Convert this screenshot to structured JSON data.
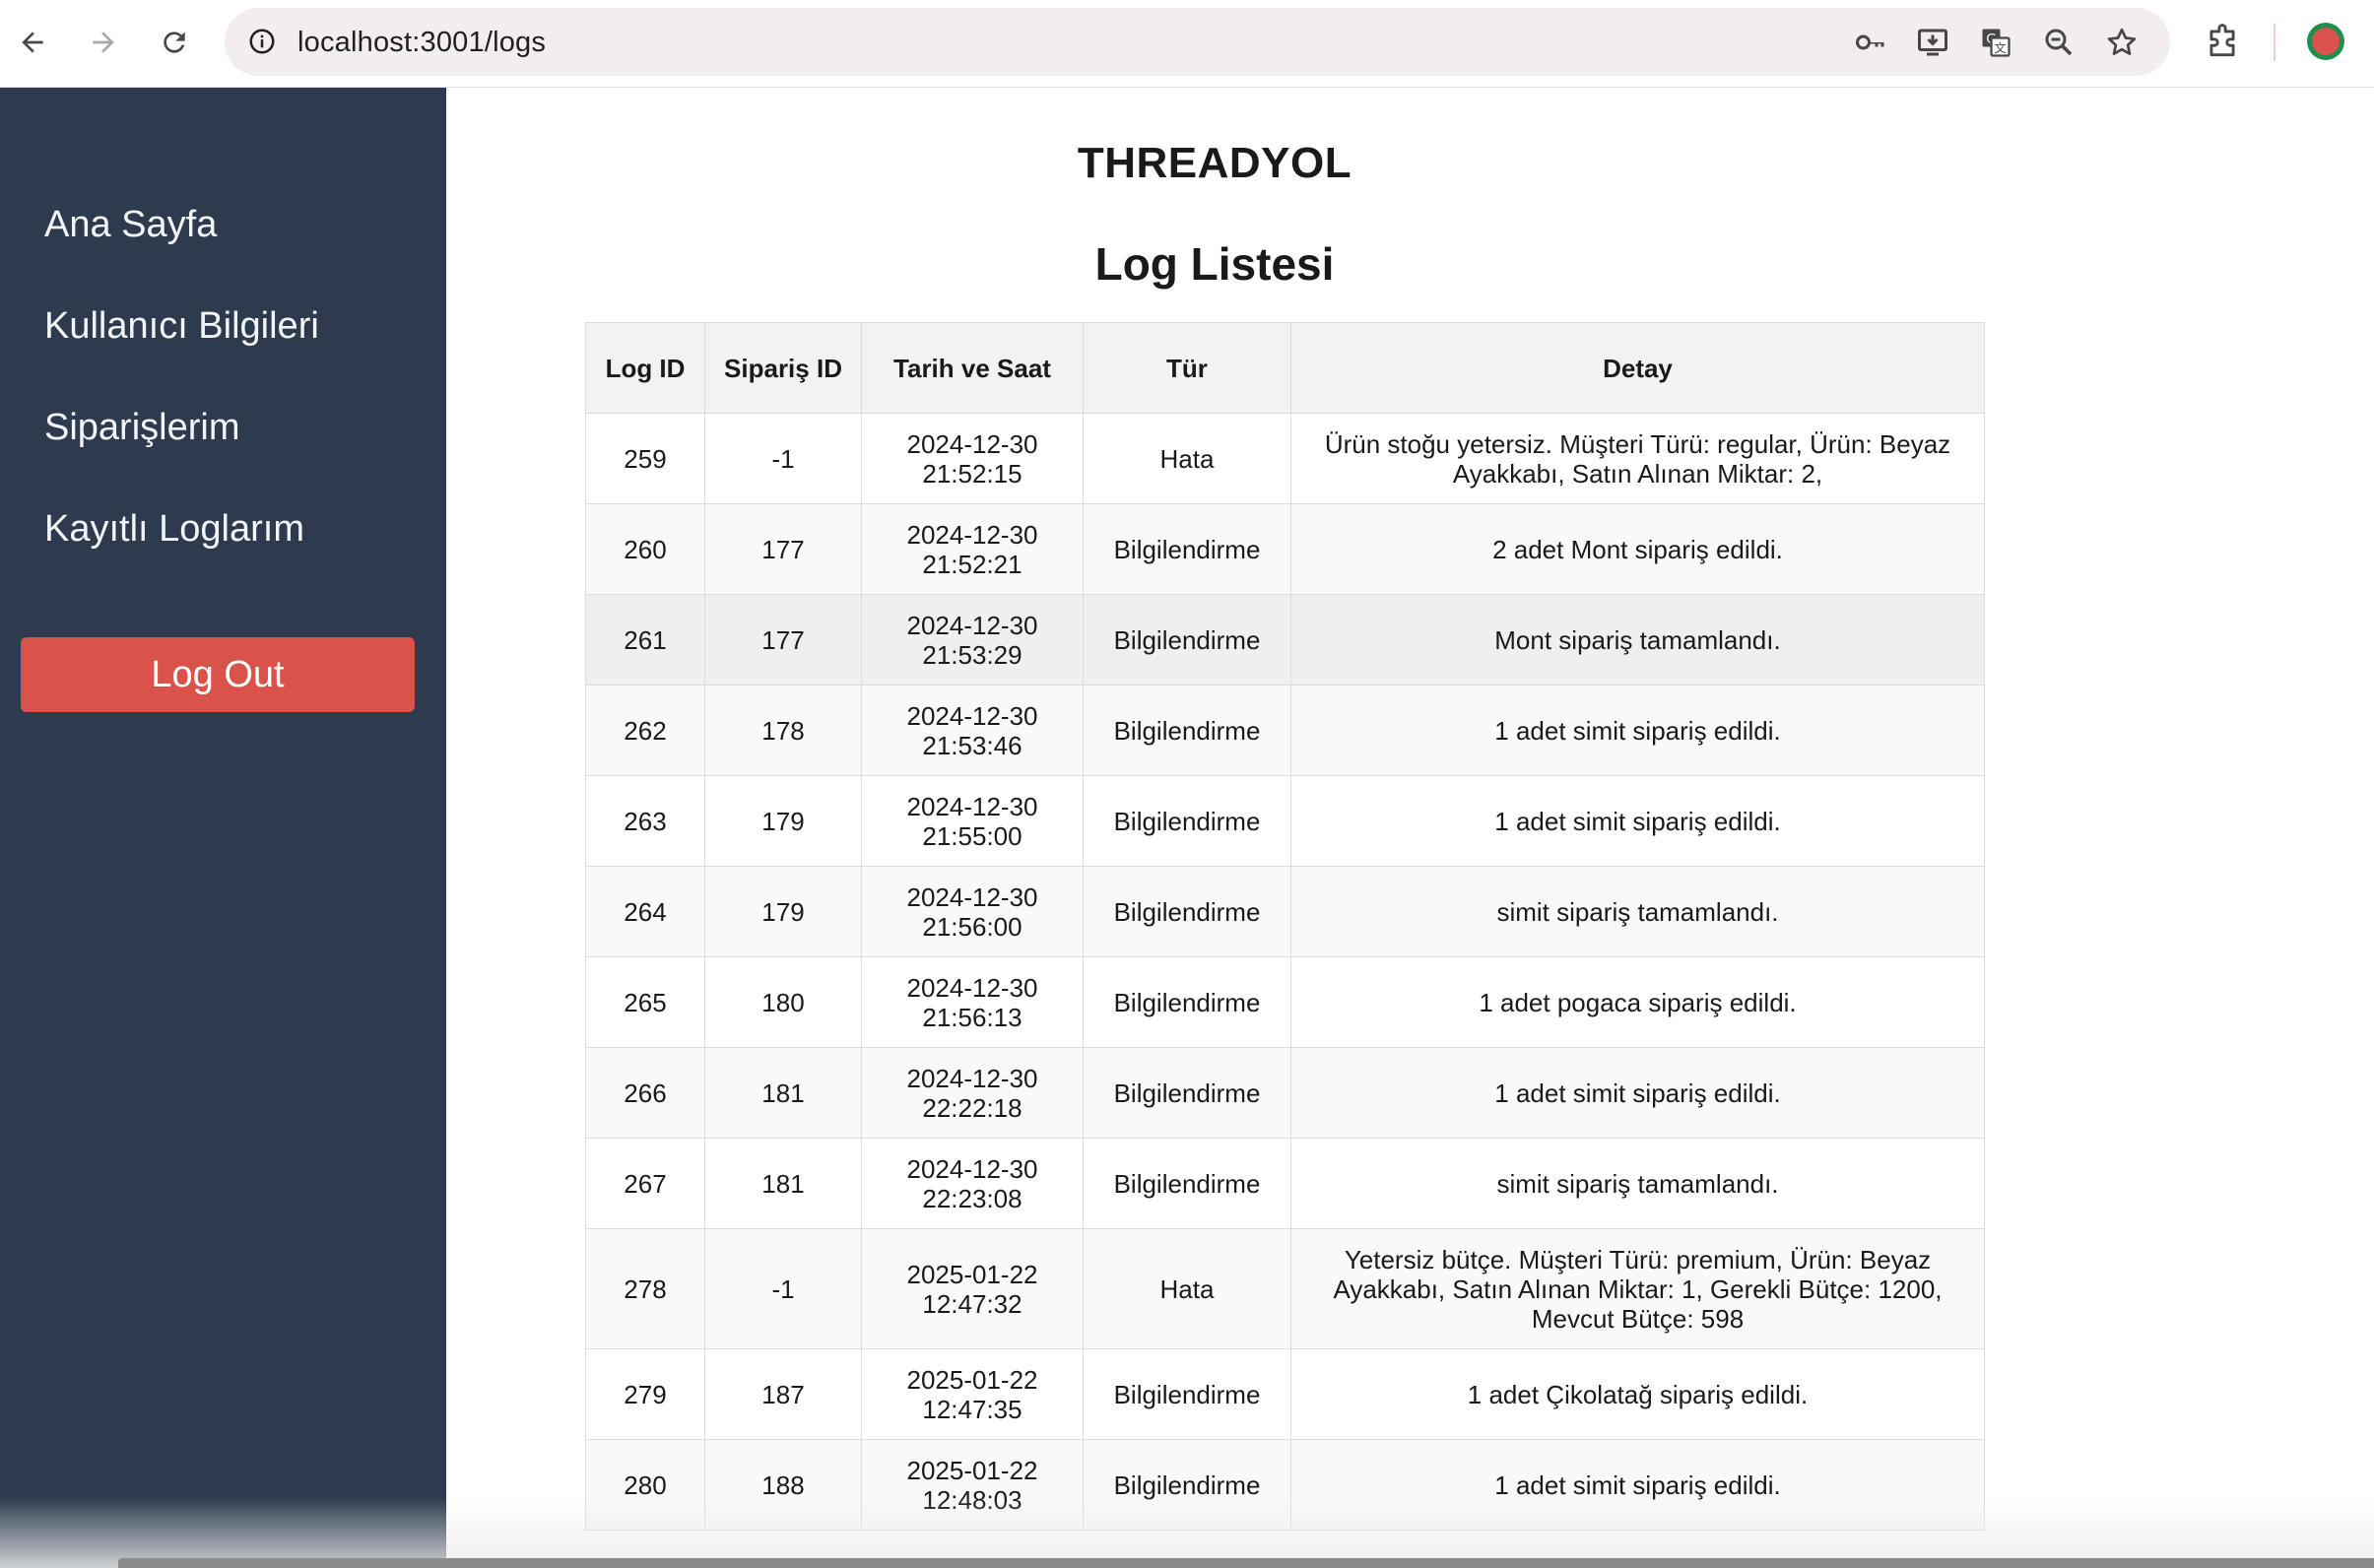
{
  "browser": {
    "url": "localhost:3001/logs"
  },
  "sidebar": {
    "items": [
      {
        "label": "Ana Sayfa"
      },
      {
        "label": "Kullanıcı Bilgileri"
      },
      {
        "label": "Siparişlerim"
      },
      {
        "label": "Kayıtlı Loglarım"
      }
    ],
    "logout_label": "Log Out"
  },
  "main": {
    "brand": "THREADYOL",
    "title": "Log Listesi"
  },
  "table": {
    "headers": {
      "log_id": "Log ID",
      "siparis_id": "Sipariş ID",
      "tarih": "Tarih ve Saat",
      "tur": "Tür",
      "detay": "Detay"
    },
    "rows": [
      {
        "log_id": "259",
        "siparis_id": "-1",
        "date": "2024-12-30",
        "time": "21:52:15",
        "type": "Hata",
        "detail": "Ürün stoğu yetersiz. Müşteri Türü: regular, Ürün: Beyaz Ayakkabı, Satın Alınan Miktar: 2,"
      },
      {
        "log_id": "260",
        "siparis_id": "177",
        "date": "2024-12-30",
        "time": "21:52:21",
        "type": "Bilgilendirme",
        "detail": "2 adet Mont sipariş edildi."
      },
      {
        "log_id": "261",
        "siparis_id": "177",
        "date": "2024-12-30",
        "time": "21:53:29",
        "type": "Bilgilendirme",
        "detail": "Mont sipariş tamamlandı."
      },
      {
        "log_id": "262",
        "siparis_id": "178",
        "date": "2024-12-30",
        "time": "21:53:46",
        "type": "Bilgilendirme",
        "detail": "1 adet simit sipariş edildi."
      },
      {
        "log_id": "263",
        "siparis_id": "179",
        "date": "2024-12-30",
        "time": "21:55:00",
        "type": "Bilgilendirme",
        "detail": "1 adet simit sipariş edildi."
      },
      {
        "log_id": "264",
        "siparis_id": "179",
        "date": "2024-12-30",
        "time": "21:56:00",
        "type": "Bilgilendirme",
        "detail": "simit sipariş tamamlandı."
      },
      {
        "log_id": "265",
        "siparis_id": "180",
        "date": "2024-12-30",
        "time": "21:56:13",
        "type": "Bilgilendirme",
        "detail": "1 adet pogaca sipariş edildi."
      },
      {
        "log_id": "266",
        "siparis_id": "181",
        "date": "2024-12-30",
        "time": "22:22:18",
        "type": "Bilgilendirme",
        "detail": "1 adet simit sipariş edildi."
      },
      {
        "log_id": "267",
        "siparis_id": "181",
        "date": "2024-12-30",
        "time": "22:23:08",
        "type": "Bilgilendirme",
        "detail": "simit sipariş tamamlandı."
      },
      {
        "log_id": "278",
        "siparis_id": "-1",
        "date": "2025-01-22",
        "time": "12:47:32",
        "type": "Hata",
        "detail": "Yetersiz bütçe. Müşteri Türü: premium, Ürün: Beyaz Ayakkabı, Satın Alınan Miktar: 1, Gerekli Bütçe: 1200, Mevcut Bütçe: 598"
      },
      {
        "log_id": "279",
        "siparis_id": "187",
        "date": "2025-01-22",
        "time": "12:47:35",
        "type": "Bilgilendirme",
        "detail": "1 adet Çikolatağ sipariş edildi."
      },
      {
        "log_id": "280",
        "siparis_id": "188",
        "date": "2025-01-22",
        "time": "12:48:03",
        "type": "Bilgilendirme",
        "detail": "1 adet simit sipariş edildi."
      }
    ]
  },
  "colors": {
    "sidebar_bg": "#2e3b4e",
    "logout_bg": "#d9534a",
    "header_bg": "#f2f2f2"
  },
  "icons": [
    "back-arrow-icon",
    "forward-arrow-icon",
    "reload-icon",
    "site-info-icon",
    "password-key-icon",
    "install-app-icon",
    "translate-icon",
    "zoom-icon",
    "bookmark-star-icon",
    "extensions-puzzle-icon",
    "profile-avatar"
  ]
}
